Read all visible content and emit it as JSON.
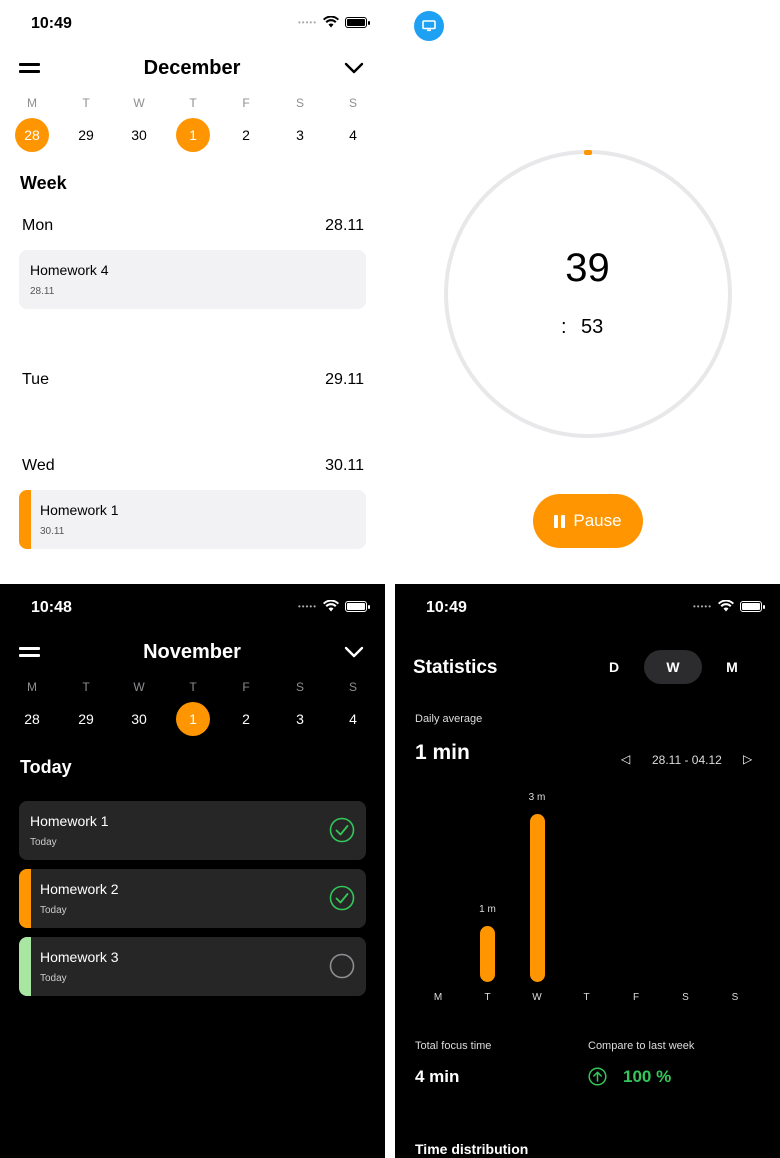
{
  "colors": {
    "accent": "#ff9500",
    "success": "#34c759",
    "mint": "#a8e6a1"
  },
  "calendar_light": {
    "status_time": "10:49",
    "month": "December",
    "weekdays": [
      "M",
      "T",
      "W",
      "T",
      "F",
      "S",
      "S"
    ],
    "days": [
      "28",
      "29",
      "30",
      "1",
      "2",
      "3",
      "4"
    ],
    "section_title": "Week",
    "groups": [
      {
        "day": "Mon",
        "date": "28.11",
        "tasks": [
          {
            "title": "Homework 4",
            "subtitle": "28.11"
          }
        ]
      },
      {
        "day": "Tue",
        "date": "29.11",
        "tasks": []
      },
      {
        "day": "Wed",
        "date": "30.11",
        "tasks": [
          {
            "title": "Homework 1",
            "subtitle": "30.11"
          }
        ]
      }
    ]
  },
  "timer": {
    "minutes": "39",
    "separator": ":",
    "seconds": "53",
    "pause_label": "Pause",
    "icon": "monitor-icon"
  },
  "calendar_dark": {
    "status_time": "10:48",
    "month": "November",
    "weekdays": [
      "M",
      "T",
      "W",
      "T",
      "F",
      "S",
      "S"
    ],
    "days": [
      "28",
      "29",
      "30",
      "1",
      "2",
      "3",
      "4"
    ],
    "section_title": "Today",
    "tasks": [
      {
        "title": "Homework 1",
        "subtitle": "Today",
        "done": true
      },
      {
        "title": "Homework 2",
        "subtitle": "Today",
        "done": true
      },
      {
        "title": "Homework 3",
        "subtitle": "Today",
        "done": false
      }
    ]
  },
  "statistics": {
    "status_time": "10:49",
    "title": "Statistics",
    "segments": [
      "D",
      "W",
      "M"
    ],
    "selected_segment": "W",
    "daily_average_label": "Daily average",
    "daily_average_value": "1 min",
    "range": "28.11 - 04.12",
    "prev_arrow": "◁",
    "next_arrow": "▷",
    "total_label": "Total focus time",
    "total_value": "4 min",
    "compare_label": "Compare to last week",
    "compare_value": "100 %",
    "distribution_label": "Time distribution"
  },
  "chart_data": {
    "type": "bar",
    "categories": [
      "M",
      "T",
      "W",
      "T",
      "F",
      "S",
      "S"
    ],
    "values": [
      0,
      1,
      3,
      0,
      0,
      0,
      0
    ],
    "data_labels": [
      "",
      "1 m",
      "3 m",
      "",
      "",
      "",
      ""
    ],
    "unit": "m"
  }
}
